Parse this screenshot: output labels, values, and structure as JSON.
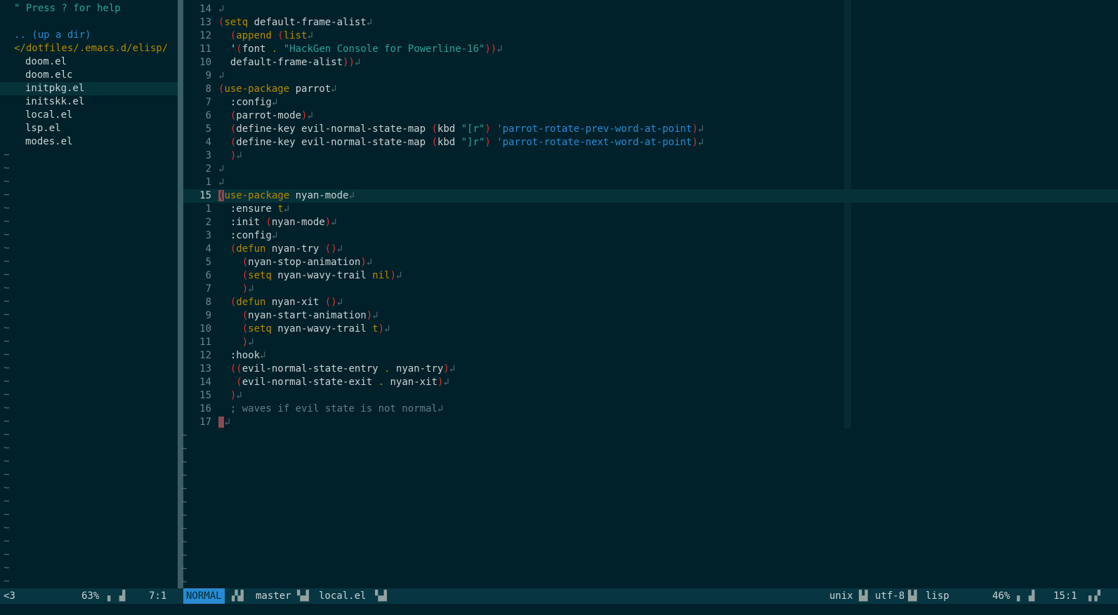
{
  "tree": {
    "help": "\" Press ? for help",
    "updir": ".. (up a dir)",
    "dir": "</dotfiles/.emacs.d/elisp/",
    "files": [
      "doom.el",
      "doom.elc",
      "initpkg.el",
      "initskk.el",
      "local.el",
      "lsp.el",
      "modes.el"
    ],
    "selected_file": "initpkg.el",
    "empty_marker": "~"
  },
  "editor": {
    "filename": "local.el",
    "lines": [
      {
        "num": "14",
        "text": ""
      },
      {
        "num": "13",
        "text": "(setq default-frame-alist"
      },
      {
        "num": "12",
        "text": "  (append (list"
      },
      {
        "num": "11",
        "text": "  '(font . \"HackGen Console for Powerline-16\"))"
      },
      {
        "num": "10",
        "text": "  default-frame-alist))"
      },
      {
        "num": "9",
        "text": ""
      },
      {
        "num": "8",
        "text": "(use-package parrot"
      },
      {
        "num": "7",
        "text": "  :config"
      },
      {
        "num": "6",
        "text": "  (parrot-mode)"
      },
      {
        "num": "5",
        "text": "  (define-key evil-normal-state-map (kbd \"[r\") 'parrot-rotate-prev-word-at-point)"
      },
      {
        "num": "4",
        "text": "  (define-key evil-normal-state-map (kbd \"]r\") 'parrot-rotate-next-word-at-point)"
      },
      {
        "num": "3",
        "text": "  )"
      },
      {
        "num": "2",
        "text": ""
      },
      {
        "num": "1",
        "text": ""
      },
      {
        "num": "15",
        "text": "(use-package nyan-mode"
      },
      {
        "num": "1",
        "text": "  :ensure t"
      },
      {
        "num": "2",
        "text": "  :init (nyan-mode)"
      },
      {
        "num": "3",
        "text": "  :config"
      },
      {
        "num": "4",
        "text": "  (defun nyan-try ()"
      },
      {
        "num": "5",
        "text": "    (nyan-stop-animation)"
      },
      {
        "num": "6",
        "text": "    (setq nyan-wavy-trail nil)"
      },
      {
        "num": "7",
        "text": "    )"
      },
      {
        "num": "8",
        "text": "  (defun nyan-xit ()"
      },
      {
        "num": "9",
        "text": "    (nyan-start-animation)"
      },
      {
        "num": "10",
        "text": "    (setq nyan-wavy-trail t)"
      },
      {
        "num": "11",
        "text": "    )"
      },
      {
        "num": "12",
        "text": "  :hook"
      },
      {
        "num": "13",
        "text": "  ((evil-normal-state-entry . nyan-try)"
      },
      {
        "num": "14",
        "text": "   (evil-normal-state-exit . nyan-xit)"
      },
      {
        "num": "15",
        "text": "  )"
      },
      {
        "num": "16",
        "text": "  ; waves if evil state is not normal"
      },
      {
        "num": "17",
        "text": ""
      }
    ],
    "cursor_line_index": 14
  },
  "statusline": {
    "left_tag": "<3",
    "tree_percent": "63%",
    "tree_pos": "7:1",
    "mode": "NORMAL",
    "branch": "master",
    "file": "local.el",
    "fileformat": "unix",
    "encoding": "utf-8",
    "filetype": "lisp",
    "percent": "46%",
    "position": "15:1"
  },
  "colors": {
    "background": "#01212a",
    "keyword": "#b58900",
    "paren": "#dc322f",
    "string": "#2aa198",
    "symbol": "#268bd2",
    "comment": "#657b83",
    "mode_bg": "#268bd2"
  }
}
